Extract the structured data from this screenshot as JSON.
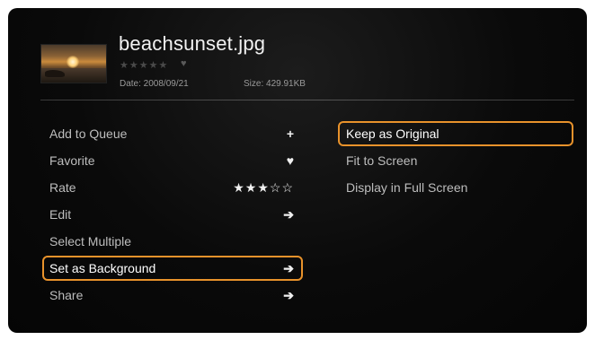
{
  "header": {
    "filename": "beachsunset.jpg",
    "stars": "★★★★★",
    "heart": "♥",
    "date": "Date: 2008/09/21",
    "size": "Size: 429.91KB"
  },
  "menu": {
    "items": [
      {
        "label": "Add to Queue",
        "icon": "plus-icon",
        "glyph": "+"
      },
      {
        "label": "Favorite",
        "icon": "heart-icon",
        "glyph": "♥"
      },
      {
        "label": "Rate",
        "icon": "rating-stars",
        "glyph": "★★★☆☆",
        "rating": 3
      },
      {
        "label": "Edit",
        "icon": "arrow-right-icon",
        "glyph": "➔"
      },
      {
        "label": "Select Multiple",
        "icon": "",
        "glyph": ""
      },
      {
        "label": "Set as Background",
        "icon": "arrow-right-icon",
        "glyph": "➔",
        "selected": true
      },
      {
        "label": "Share",
        "icon": "arrow-right-icon",
        "glyph": "➔"
      }
    ]
  },
  "submenu": {
    "items": [
      {
        "label": "Keep as Original",
        "selected": true
      },
      {
        "label": "Fit to Screen"
      },
      {
        "label": "Display in Full Screen"
      }
    ]
  },
  "colors": {
    "accent": "#e8922b",
    "background": "#0a0a0a",
    "text": "#bdbdbd"
  }
}
